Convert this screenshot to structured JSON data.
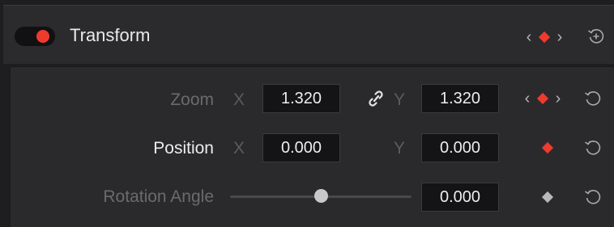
{
  "header": {
    "title": "Transform",
    "enabled": true,
    "accent_color": "#ef3b2e"
  },
  "zoom": {
    "label": "Zoom",
    "x_axis": "X",
    "x_value": "1.320",
    "y_axis": "Y",
    "y_value": "1.320",
    "linked": true
  },
  "position": {
    "label": "Position",
    "x_axis": "X",
    "x_value": "0.000",
    "y_axis": "Y",
    "y_value": "0.000"
  },
  "rotation": {
    "label": "Rotation Angle",
    "value": "0.000",
    "slider_fraction": 0.5
  },
  "icons": {
    "keyframe_prev": "chevron-left-icon",
    "keyframe_next": "chevron-right-icon",
    "keyframe": "diamond-keyframe-icon",
    "reset": "reset-icon",
    "link": "link-icon",
    "add": "add-reset-icon"
  }
}
